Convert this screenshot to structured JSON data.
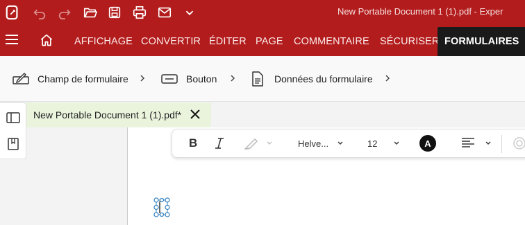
{
  "app": {
    "title": "New Portable Document 1 (1).pdf   -   Exper",
    "accent": "#b31c1c"
  },
  "quick_access": {
    "icons": [
      "app-logo-icon",
      "undo-icon",
      "redo-icon",
      "open-folder-icon",
      "save-icon",
      "print-icon",
      "mail-icon",
      "chevron-down-icon"
    ]
  },
  "menu": {
    "items": [
      {
        "label": "AFFICHAGE"
      },
      {
        "label": "CONVERTIR"
      },
      {
        "label": "ÉDITER"
      },
      {
        "label": "PAGE"
      },
      {
        "label": "COMMENTAIRE"
      },
      {
        "label": "SÉCURISER"
      },
      {
        "label": "FORMULAIRES"
      }
    ],
    "active": "FORMULAIRES"
  },
  "ribbon": {
    "items": [
      {
        "label": "Champ de formulaire"
      },
      {
        "label": "Bouton"
      },
      {
        "label": "Données du formulaire"
      }
    ]
  },
  "document": {
    "tab_label": "New Portable Document 1 (1).pdf*"
  },
  "format_toolbar": {
    "font": "Helve...",
    "size": "12",
    "color_letter": "A",
    "icons": [
      "bold-icon",
      "italic-icon",
      "highlighter-icon",
      "align-left-icon"
    ]
  }
}
